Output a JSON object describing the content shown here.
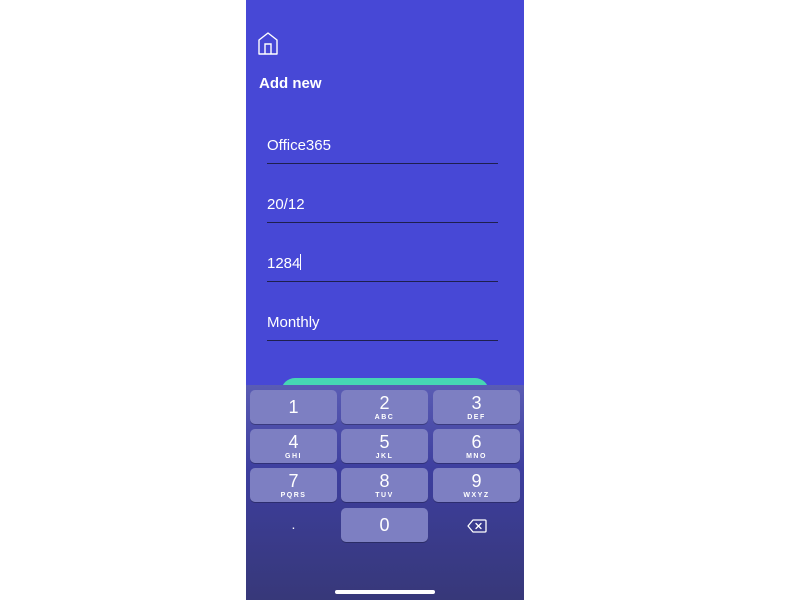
{
  "screen": {
    "title": "Add new"
  },
  "form": {
    "fields": [
      {
        "name": "service",
        "value": "Office365"
      },
      {
        "name": "date",
        "value": "20/12"
      },
      {
        "name": "amount",
        "value": "1284"
      },
      {
        "name": "frequency",
        "value": "Monthly"
      }
    ]
  },
  "keyboard": {
    "keys": [
      {
        "digit": "1",
        "letters": ""
      },
      {
        "digit": "2",
        "letters": "ABC"
      },
      {
        "digit": "3",
        "letters": "DEF"
      },
      {
        "digit": "4",
        "letters": "GHI"
      },
      {
        "digit": "5",
        "letters": "JKL"
      },
      {
        "digit": "6",
        "letters": "MNO"
      },
      {
        "digit": "7",
        "letters": "PQRS"
      },
      {
        "digit": "8",
        "letters": "TUV"
      },
      {
        "digit": "9",
        "letters": "WXYZ"
      },
      {
        "digit": "0",
        "letters": ""
      }
    ],
    "decimal_label": ".",
    "backspace_icon": "backspace-icon"
  },
  "icons": {
    "home": "home-icon"
  },
  "colors": {
    "background": "#4748d6",
    "accent_button": "#46d6b4",
    "key": "#7d7fc2",
    "field_underline": "#1e1f4e"
  }
}
